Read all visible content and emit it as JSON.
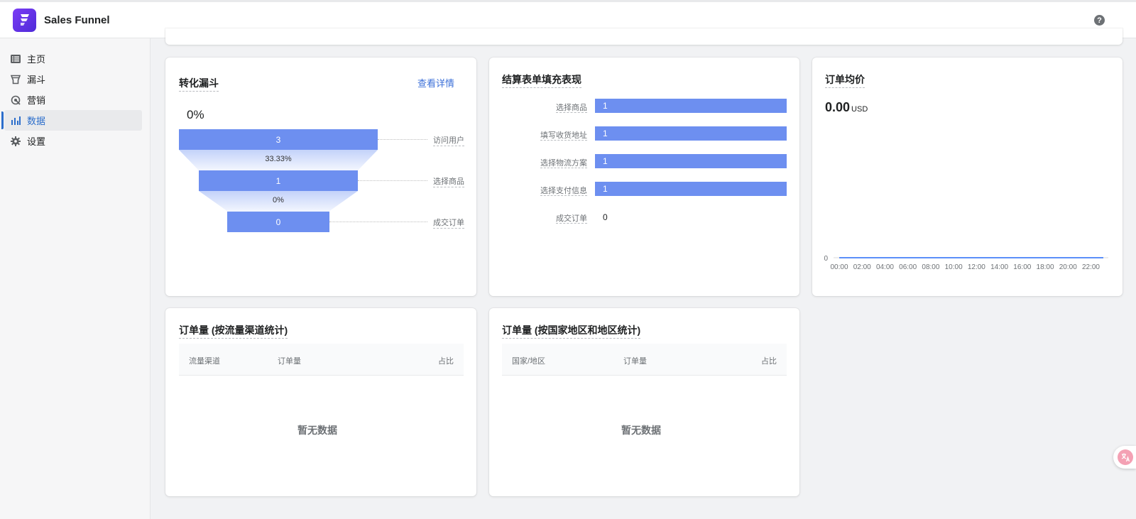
{
  "header": {
    "app_title": "Sales Funnel",
    "help_glyph": "?"
  },
  "sidebar": {
    "items": [
      {
        "label": "主页",
        "icon": "list-icon"
      },
      {
        "label": "漏斗",
        "icon": "funnel-icon"
      },
      {
        "label": "营销",
        "icon": "marketing-icon"
      },
      {
        "label": "数据",
        "icon": "bar-chart-icon",
        "active": true
      },
      {
        "label": "设置",
        "icon": "gear-icon"
      }
    ]
  },
  "conversion_funnel": {
    "title": "转化漏斗",
    "link": "查看详情",
    "overall_rate": "0%",
    "stages": [
      {
        "value": "3",
        "label": "访问用户"
      },
      {
        "value": "1",
        "label": "选择商品"
      },
      {
        "value": "0",
        "label": "成交订单"
      }
    ],
    "step_rates": [
      "33.33%",
      "0%"
    ]
  },
  "checkout_form": {
    "title": "结算表单填充表现",
    "rows": [
      {
        "label": "选择商品",
        "value": "1"
      },
      {
        "label": "填写收货地址",
        "value": "1"
      },
      {
        "label": "选择物流方案",
        "value": "1"
      },
      {
        "label": "选择支付信息",
        "value": "1"
      },
      {
        "label": "成交订单",
        "value": "0"
      }
    ]
  },
  "avg_order": {
    "title": "订单均价",
    "value": "0.00",
    "currency": "USD"
  },
  "chart_data": {
    "type": "line",
    "title": "",
    "x": [
      "00:00",
      "02:00",
      "04:00",
      "06:00",
      "08:00",
      "10:00",
      "12:00",
      "14:00",
      "16:00",
      "18:00",
      "20:00",
      "22:00"
    ],
    "series": [
      {
        "values": [
          0,
          0,
          0,
          0,
          0,
          0,
          0,
          0,
          0,
          0,
          0,
          0
        ]
      }
    ],
    "y_ticks": [
      "0"
    ],
    "xlabel": "",
    "ylabel": "",
    "grid": false
  },
  "orders_by_channel": {
    "title": "订单量 (按流量渠道统计)",
    "columns": [
      "流量渠道",
      "订单量",
      "占比"
    ],
    "empty_text": "暂无数据"
  },
  "orders_by_region": {
    "title": "订单量 (按国家地区和地区统计)",
    "columns": [
      "国家/地区",
      "订单量",
      "占比"
    ],
    "empty_text": "暂无数据"
  },
  "colors": {
    "accent": "#2c6ecb",
    "bar": "#6d8ff0",
    "line": "#5b8ff9"
  }
}
